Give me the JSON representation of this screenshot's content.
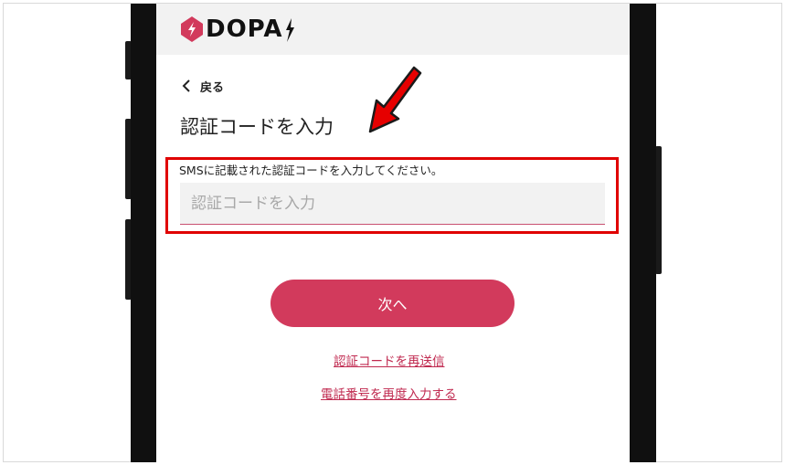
{
  "app": {
    "logo_text": "DOPA",
    "brand_color": "#d23a5c"
  },
  "nav": {
    "back_label": "戻る",
    "back_icon": "chevron-left-icon"
  },
  "page": {
    "title": "認証コードを入力"
  },
  "form": {
    "instruction": "SMSに記載された認証コードを入力してください。",
    "code_value": "",
    "code_placeholder": "認証コードを入力",
    "submit_label": "次へ"
  },
  "links": {
    "resend": "認証コードを再送信",
    "reenter_phone": "電話番号を再度入力する"
  },
  "annotations": {
    "highlight_color": "#e00000",
    "arrow_icon": "red-arrow-icon"
  }
}
